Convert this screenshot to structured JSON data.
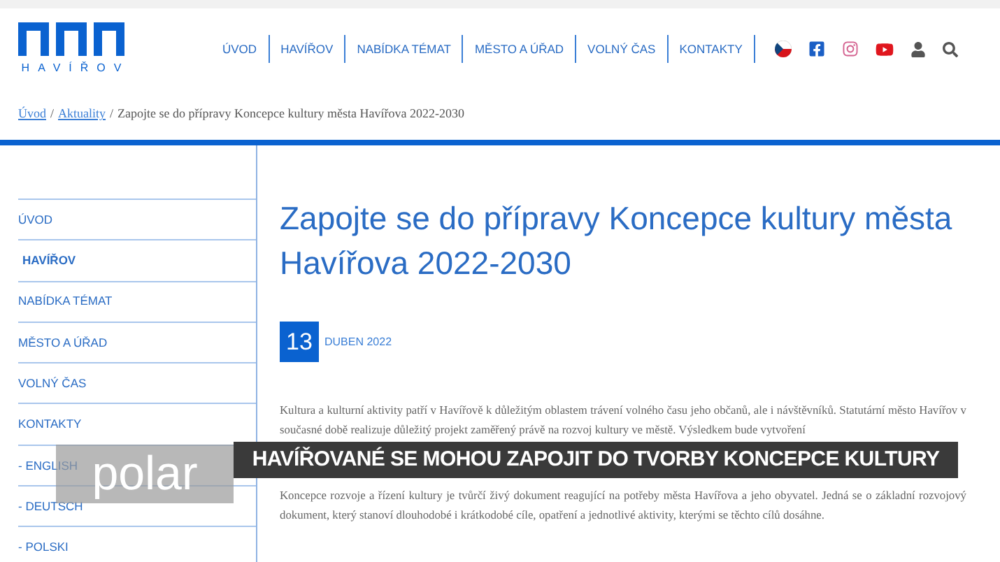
{
  "logo": {
    "text": "HAVÍŘOV"
  },
  "nav": [
    {
      "label": "ÚVOD"
    },
    {
      "label": "HAVÍŘOV"
    },
    {
      "label": "NABÍDKA TÉMAT"
    },
    {
      "label": "MĚSTO A ÚŘAD"
    },
    {
      "label": "VOLNÝ ČAS"
    },
    {
      "label": "KONTAKTY"
    }
  ],
  "breadcrumb": [
    {
      "label": "Úvod",
      "kind": "link"
    },
    {
      "label": "/",
      "kind": "separator"
    },
    {
      "label": "Aktuality",
      "kind": "link"
    },
    {
      "label": "/",
      "kind": "separator"
    },
    {
      "label": "Zapojte se do přípravy Koncepce kultury města Havířova 2022-2030",
      "kind": "current"
    }
  ],
  "sidebar": {
    "items": [
      {
        "label": "ÚVOD",
        "selected": false
      },
      {
        "label": "HAVÍŘOV",
        "selected": true
      },
      {
        "label": "NABÍDKA TÉMAT",
        "selected": false
      },
      {
        "label": "MĚSTO A ÚŘAD",
        "selected": false
      },
      {
        "label": "VOLNÝ ČAS",
        "selected": false
      },
      {
        "label": "KONTAKTY",
        "selected": false
      },
      {
        "label": "- ENGLISH",
        "selected": false
      },
      {
        "label": "- DEUTSCH",
        "selected": false
      },
      {
        "label": "- POLSKI",
        "selected": false
      }
    ]
  },
  "article": {
    "title": "Zapojte se do přípravy Koncepce kultury města Havířova 2022-2030",
    "day": "13",
    "month": "DUBEN 2022",
    "paragraphs": [
      "Kultura a kulturní aktivity patří v Havířově k důležitým oblastem trávení volného času jeho občanů, ale i návštěvníků. Statutární město Havířov v současné době realizuje důležitý projekt zaměřený právě na rozvoj kultury ve městě. Výsledkem bude vytvoření",
      "Koncepce rozvoje a řízení kultury je tvůrčí živý dokument reagující na potřeby města Havířova a jeho obyvatel. Jedná se o základní rozvojový dokument, který stanoví dlouhodobé i krátkodobé cíle, opatření a jednotlivé aktivity, kterými se těchto cílů dosáhne."
    ]
  },
  "overlay": {
    "logo": "polar",
    "caption": "HAVÍŘOVANÉ SE MOHOU ZAPOJIT DO TVORBY KONCEPCE KULTURY"
  }
}
